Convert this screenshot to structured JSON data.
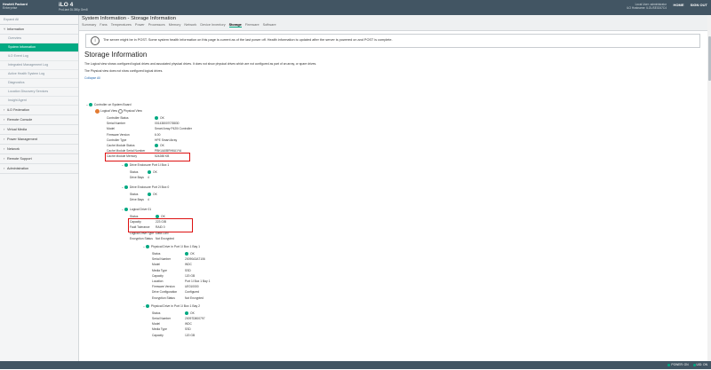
{
  "header": {
    "brand_line1": "Hewlett Packard",
    "brand_line2": "Enterprise",
    "product": "iLO 4",
    "product_sub": "ProLiant DL380p Gen8",
    "user_line1": "Local User: administrator",
    "user_line2": "iLO Hostname: ILOUSE0247C4",
    "home": "HOME",
    "sign_out": "SIGN OUT"
  },
  "sidebar": {
    "expand_all": "Expand All",
    "groups": [
      {
        "label": "Information",
        "chevron": "down",
        "children": [
          {
            "label": "Overview",
            "active": false
          },
          {
            "label": "System Information",
            "active": true
          },
          {
            "label": "iLO Event Log",
            "active": false
          },
          {
            "label": "Integrated Management Log",
            "active": false
          },
          {
            "label": "Active Health System Log",
            "active": false
          },
          {
            "label": "Diagnostics",
            "active": false
          },
          {
            "label": "Location Discovery Services",
            "active": false
          },
          {
            "label": "Insight Agent",
            "active": false
          }
        ]
      },
      {
        "label": "iLO Federation",
        "chevron": "right"
      },
      {
        "label": "Remote Console",
        "chevron": "right"
      },
      {
        "label": "Virtual Media",
        "chevron": "right"
      },
      {
        "label": "Power Management",
        "chevron": "right"
      },
      {
        "label": "Network",
        "chevron": "right"
      },
      {
        "label": "Remote Support",
        "chevron": "right"
      },
      {
        "label": "Administration",
        "chevron": "right"
      }
    ]
  },
  "page": {
    "title": "System Information - Storage Information",
    "tabs": [
      "Summary",
      "Fans",
      "Temperatures",
      "Power",
      "Processors",
      "Memory",
      "Network",
      "Device Inventory",
      "Storage",
      "Firmware",
      "Software"
    ],
    "active_tab": "Storage",
    "notice": "The server might be in POST. Some system health information on this page is current as of the last power off. Health information is updated after the server is powered on and POST is complete.",
    "section_title": "Storage Information",
    "desc_logical": "The Logical view shows configured logical drives and associated physical drives. It does not show physical drives which are not configured as part of an array, or spare drives.",
    "desc_physical": "The Physical view does not show configured logical drives.",
    "collapse_all": "Collapse All"
  },
  "tree": {
    "controller_label": "Controller on System Board",
    "view_logical": "Logical View",
    "view_physical": "Physical View",
    "controller_props": [
      {
        "k": "Controller Status",
        "v": "OK",
        "ok": true
      },
      {
        "k": "Serial Number",
        "v": "001438007078830",
        "ok": false
      },
      {
        "k": "Model",
        "v": "Smart Array P420i Controller",
        "ok": false
      },
      {
        "k": "Firmware Version",
        "v": "6.00",
        "ok": false
      },
      {
        "k": "Controller Type",
        "v": "HPE Smart Array",
        "ok": false
      },
      {
        "k": "Cache Module Status",
        "v": "OK",
        "ok": true
      },
      {
        "k": "Cache Module Serial Number",
        "v": "PBKUA0BRH6U1YA",
        "ok": false
      },
      {
        "k": "Cache Module Memory",
        "v": "524288 KB",
        "ok": false
      }
    ],
    "enclosures": [
      {
        "label": "Drive Enclosure Port 1I Box 1",
        "status": "OK",
        "bays": "4"
      },
      {
        "label": "Drive Enclosure Port 2I Box 0",
        "status": "OK",
        "bays": "4"
      }
    ],
    "enclosure_status_key": "Status",
    "enclosure_bays_key": "Drive Bays",
    "logical_drive": {
      "label": "Logical Drive 01",
      "props": [
        {
          "k": "Status",
          "v": "OK",
          "ok": true
        },
        {
          "k": "Capacity",
          "v": "223 GiB",
          "ok": false
        },
        {
          "k": "Fault Tolerance",
          "v": "RAID 0",
          "ok": false
        },
        {
          "k": "Logical Drive Type",
          "v": "Data LUN",
          "ok": false
        },
        {
          "k": "Encryption Status",
          "v": "Not Encrypted",
          "ok": false
        }
      ]
    },
    "physical_drives": [
      {
        "label": "Physical Drive in Port 1I Box 1 Bay 1",
        "props": [
          {
            "k": "Status",
            "v": "OK",
            "ok": true
          },
          {
            "k": "Serial Number",
            "v": "20090A3A7106",
            "ok": false
          },
          {
            "k": "Model",
            "v": "WDC",
            "ok": false
          },
          {
            "k": "Media Type",
            "v": "SSD",
            "ok": false
          },
          {
            "k": "Capacity",
            "v": "120 GB",
            "ok": false
          },
          {
            "k": "Location",
            "v": "Port 1I Box 1 Bay 1",
            "ok": false
          },
          {
            "k": "Firmware Version",
            "v": "UE010000",
            "ok": false
          },
          {
            "k": "Drive Configuration",
            "v": "Configured",
            "ok": false
          },
          {
            "k": "Encryption Status",
            "v": "Not Encrypted",
            "ok": false
          }
        ]
      },
      {
        "label": "Physical Drive in Port 1I Box 1 Bay 2",
        "props": [
          {
            "k": "Status",
            "v": "OK",
            "ok": true
          },
          {
            "k": "Serial Number",
            "v": "20097D800797",
            "ok": false
          },
          {
            "k": "Model",
            "v": "WDC",
            "ok": false
          },
          {
            "k": "Media Type",
            "v": "SSD",
            "ok": false
          },
          {
            "k": "Capacity",
            "v": "120 GB",
            "ok": false
          }
        ]
      }
    ]
  },
  "statusbar": {
    "power_label": "POWER: ON",
    "uid_label": "UID: ON"
  },
  "colors": {
    "topbar": "#425563",
    "accent": "#01a982",
    "highlight": "#dd1111"
  }
}
